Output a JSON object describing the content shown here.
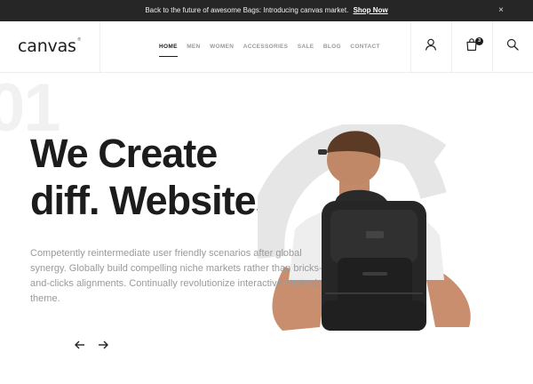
{
  "announcement": {
    "text": "Back to the future of awesome Bags: Introducing canvas market.",
    "link": "Shop Now",
    "close": "×"
  },
  "header": {
    "logo": "canvas",
    "logo_mark": "®",
    "nav": [
      "HOME",
      "MEN",
      "WOMEN",
      "ACCESSORIES",
      "SALE",
      "BLOG",
      "CONTACT"
    ],
    "active_nav": "HOME",
    "cart_count": "3",
    "icons": [
      "user-icon",
      "shopping-bag-icon",
      "search-icon"
    ]
  },
  "hero": {
    "number": "01",
    "headline_line1": "We Create",
    "headline_line2": "diff. Websites",
    "description": "Competently reintermediate user friendly scenarios after global synergy. Globally build compelling niche markets rather than bricks-and-clicks alignments. Continually revolutionize interactive strategic theme.",
    "image": "man-with-black-backpack"
  },
  "colors": {
    "dark": "#1c1c1c",
    "topbar_bg": "#262626",
    "muted": "#9a9a9a",
    "ring": "#e6e6e6"
  }
}
